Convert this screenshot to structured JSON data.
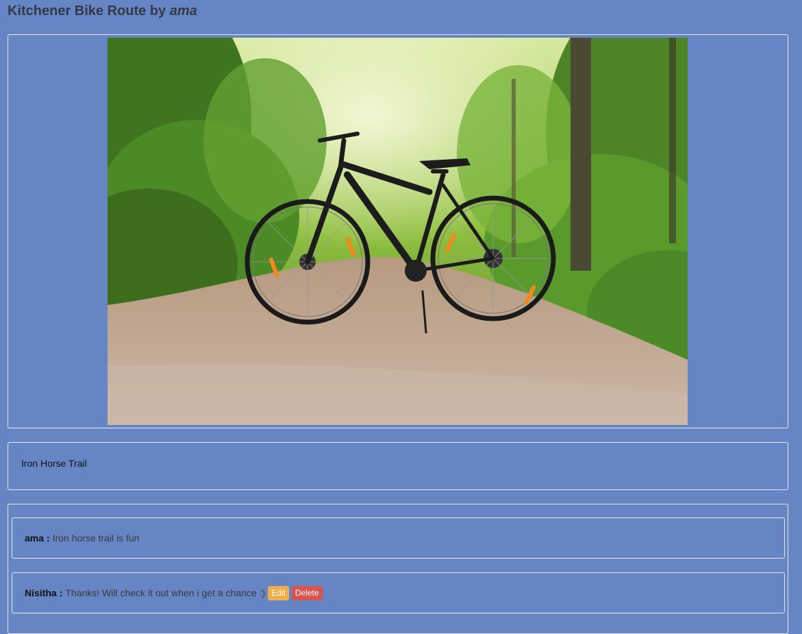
{
  "header": {
    "title_prefix": "Kitchener Bike Route by",
    "title_author": "ama"
  },
  "route": {
    "description": "Iron Horse Trail"
  },
  "comments": [
    {
      "author": "ama",
      "separator": ":",
      "text": "Iron horse trail is fun"
    },
    {
      "author": "Nisitha",
      "separator": ":",
      "text": "Thanks! Will check it out when i get a chance :)",
      "edit_label": "Edit",
      "delete_label": "Delete"
    }
  ],
  "colors": {
    "background": "#6585c5",
    "edit_button": "#f0ad4e",
    "delete_button": "#d9534f"
  }
}
